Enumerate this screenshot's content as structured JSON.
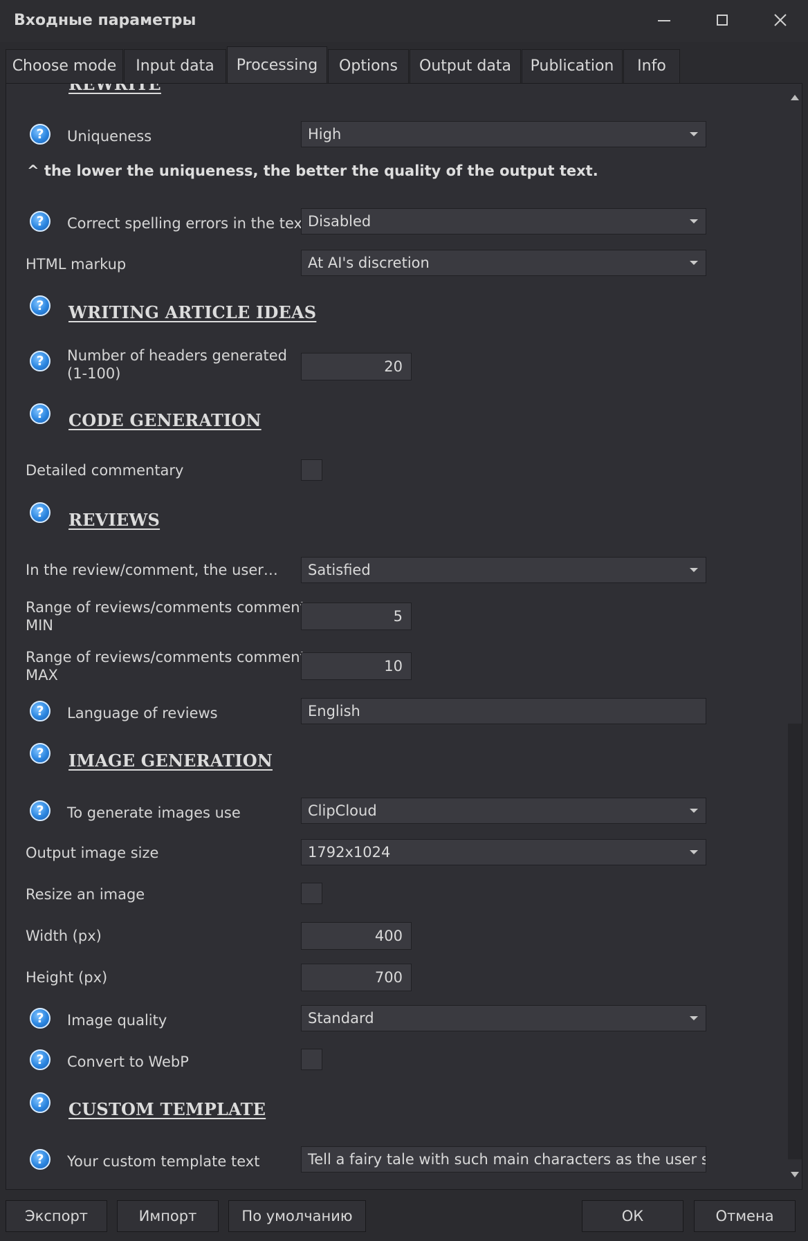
{
  "window": {
    "title": "Входные параметры",
    "minimize_icon": "minimize-icon",
    "maximize_icon": "maximize-icon",
    "close_icon": "close-icon"
  },
  "tabs": [
    {
      "label": "Choose mode"
    },
    {
      "label": "Input data"
    },
    {
      "label": "Processing",
      "active": true
    },
    {
      "label": "Options"
    },
    {
      "label": "Output data"
    },
    {
      "label": "Publication"
    },
    {
      "label": "Info"
    }
  ],
  "rewrite": {
    "section_title": "REWRITE",
    "uniqueness": {
      "label": "Uniqueness",
      "value": "High"
    },
    "note": "^ the lower the uniqueness, the better the quality of the output text.",
    "spelling": {
      "label": "Correct spelling errors in the text",
      "value": "Disabled"
    },
    "html_markup": {
      "label": "HTML markup",
      "value": "At AI's discretion"
    }
  },
  "ideas": {
    "section_title": "WRITING ARTICLE IDEAS",
    "headers": {
      "label_line1": "Number of headers generated",
      "label_line2": "(1-100)",
      "value": "20"
    }
  },
  "code": {
    "section_title": "CODE GENERATION",
    "detailed": {
      "label": "Detailed commentary",
      "checked": false
    }
  },
  "reviews": {
    "section_title": "REVIEWS",
    "user": {
      "label": "In the review/comment, the user…",
      "value": "Satisfied"
    },
    "min": {
      "label_line1": "Range of reviews/comments comments",
      "label_line2": "MIN",
      "value": "5"
    },
    "max": {
      "label_line1": "Range of reviews/comments comments",
      "label_line2": "MAX",
      "value": "10"
    },
    "language": {
      "label": "Language of reviews",
      "value": "English"
    }
  },
  "image": {
    "section_title": "IMAGE GENERATION",
    "generator": {
      "label": "To generate images use",
      "value": "ClipCloud"
    },
    "size": {
      "label": "Output image size",
      "value": "1792x1024"
    },
    "resize": {
      "label": "Resize an image",
      "checked": false
    },
    "width": {
      "label": "Width (px)",
      "value": "400"
    },
    "height": {
      "label": "Height (px)",
      "value": "700"
    },
    "quality": {
      "label": "Image quality",
      "value": "Standard"
    },
    "webp": {
      "label": "Convert to WebP",
      "checked": false
    }
  },
  "custom": {
    "section_title": "CUSTOM TEMPLATE",
    "template": {
      "label": "Your custom template text",
      "value": "Tell a fairy tale with such main characters as the user speci"
    }
  },
  "help_icon_glyph": "?",
  "footer": {
    "export": "Экспорт",
    "import": "Импорт",
    "default": "По умолчанию",
    "ok": "ОК",
    "cancel": "Отмена"
  },
  "colors": {
    "background": "#2b2b2f",
    "panel": "#2f2f34",
    "field": "#3a3a40",
    "help_icon": "#2c86e0",
    "text": "#d9d9d9"
  }
}
